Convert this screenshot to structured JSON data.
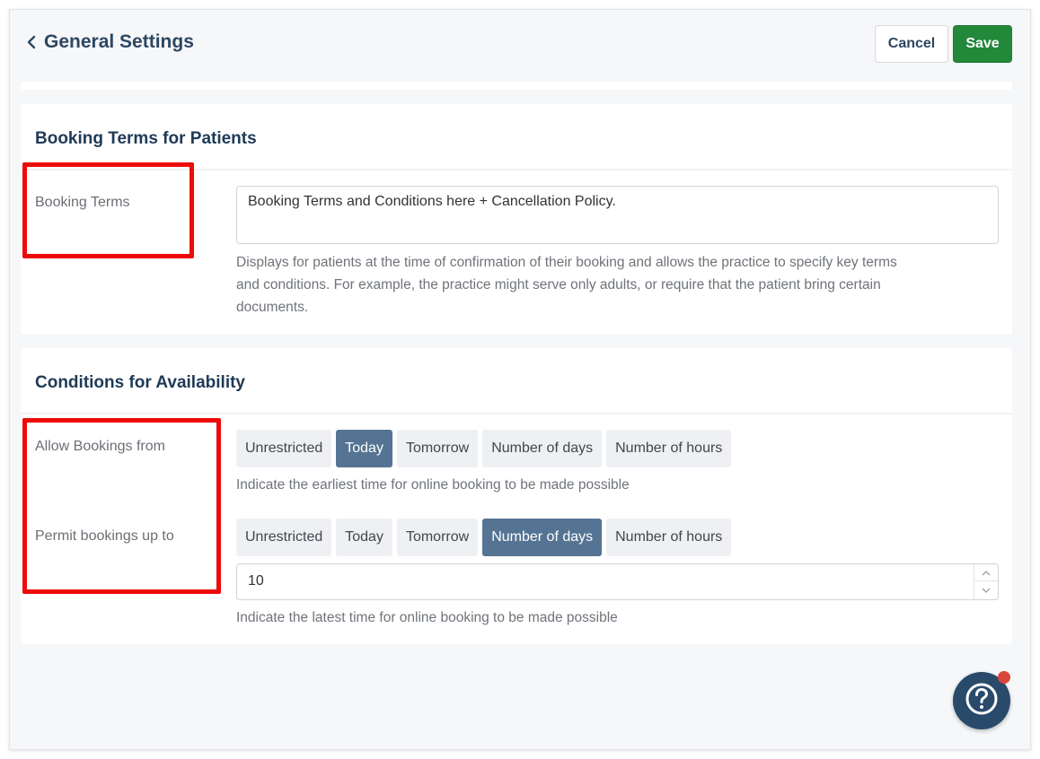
{
  "header": {
    "title": "General Settings",
    "cancel_label": "Cancel",
    "save_label": "Save"
  },
  "booking_terms_section": {
    "title": "Booking Terms for Patients",
    "field_label": "Booking Terms",
    "value": "Booking Terms and Conditions here + Cancellation Policy.",
    "help_lines": [
      "Displays for patients at the time of confirmation of their booking and allows the practice to specify key terms",
      "and conditions. For example, the practice might serve only adults, or require that the patient bring certain",
      "documents."
    ]
  },
  "availability_section": {
    "title": "Conditions for Availability",
    "allow_from": {
      "label": "Allow Bookings from",
      "options": [
        "Unrestricted",
        "Today",
        "Tomorrow",
        "Number of days",
        "Number of hours"
      ],
      "selected": "Today",
      "help": "Indicate the earliest time for online booking to be made possible"
    },
    "permit_up_to": {
      "label": "Permit bookings up to",
      "options": [
        "Unrestricted",
        "Today",
        "Tomorrow",
        "Number of days",
        "Number of hours"
      ],
      "selected": "Number of days",
      "value": "10",
      "help": "Indicate the latest time for online booking to be made possible"
    }
  },
  "colors": {
    "accent_navy": "#2d4763",
    "save_green": "#22883a",
    "segment_active": "#557493",
    "highlight_red": "#ee0a0a",
    "fab_blue": "#294a6b",
    "notification_dot": "#d9463a"
  },
  "icons": {
    "back": "chevron-left-icon",
    "help": "question-circle-icon",
    "spin_up": "chevron-up-icon",
    "spin_down": "chevron-down-icon"
  }
}
